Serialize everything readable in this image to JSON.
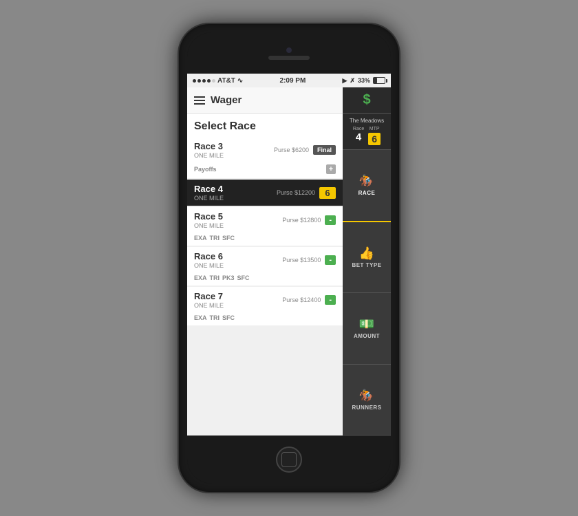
{
  "phone": {
    "status": {
      "carrier": "AT&T",
      "time": "2:09 PM",
      "battery": "33%"
    },
    "nav": {
      "title": "Wager"
    },
    "section_title": "Select Race",
    "races": [
      {
        "id": "race-3",
        "name": "Race 3",
        "distance": "ONE MILE",
        "purse": "Purse $6200",
        "badge_type": "final",
        "badge_label": "Final",
        "tags": [
          "Payoffs"
        ],
        "has_plus": true,
        "active": false
      },
      {
        "id": "race-4",
        "name": "Race 4",
        "distance": "ONE MILE",
        "purse": "Purse $12200",
        "badge_type": "number",
        "badge_label": "6",
        "tags": [],
        "has_plus": false,
        "active": true
      },
      {
        "id": "race-5",
        "name": "Race 5",
        "distance": "ONE MILE",
        "purse": "Purse $12800",
        "badge_type": "minus",
        "badge_label": "-",
        "tags": [
          "EXA",
          "TRI",
          "SFC"
        ],
        "has_plus": false,
        "active": false
      },
      {
        "id": "race-6",
        "name": "Race 6",
        "distance": "ONE MILE",
        "purse": "Purse $13500",
        "badge_type": "minus",
        "badge_label": "-",
        "tags": [
          "EXA",
          "TRI",
          "PK3",
          "SFC"
        ],
        "has_plus": false,
        "active": false
      },
      {
        "id": "race-7",
        "name": "Race 7",
        "distance": "ONE MILE",
        "purse": "Purse $12400",
        "badge_type": "minus",
        "badge_label": "-",
        "tags": [
          "EXA",
          "TRI",
          "SFC"
        ],
        "has_plus": false,
        "active": false
      }
    ],
    "sidebar": {
      "venue": "The Meadows",
      "race_label": "Race",
      "mtp_label": "MTP",
      "race_number": "4",
      "mtp_number": "6",
      "nav_items": [
        {
          "id": "race",
          "label": "RACE",
          "icon": "🏇",
          "active": true
        },
        {
          "id": "bet-type",
          "label": "BET TYPE",
          "icon": "👍",
          "active": false
        },
        {
          "id": "amount",
          "label": "AMOUNT",
          "icon": "💵",
          "active": false
        },
        {
          "id": "runners",
          "label": "RUNNERS",
          "icon": "🏇",
          "active": false
        }
      ]
    }
  }
}
